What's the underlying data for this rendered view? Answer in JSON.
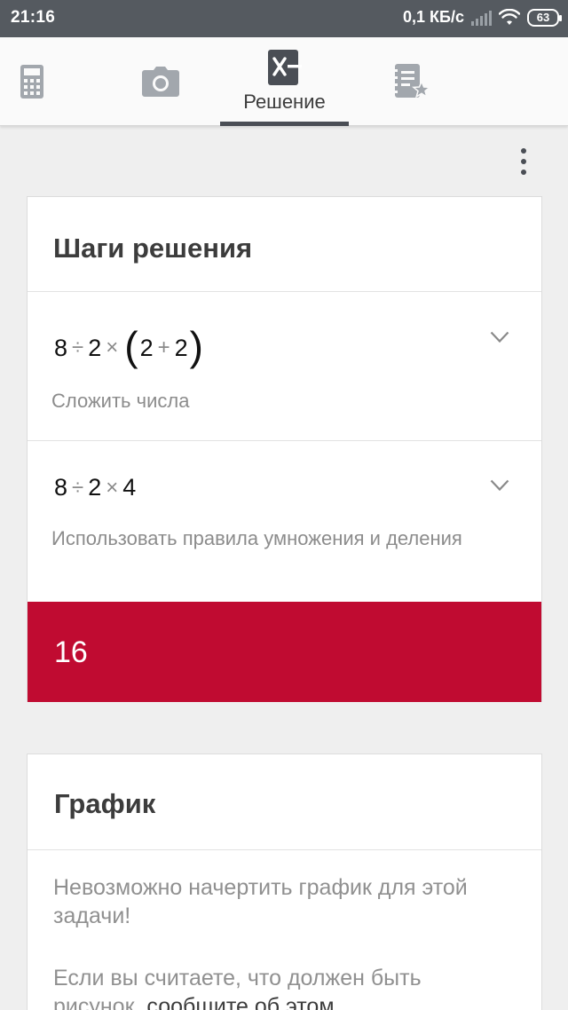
{
  "status_bar": {
    "time": "21:16",
    "network_speed": "0,1 КБ/с",
    "battery": "63"
  },
  "tabs": [
    {
      "icon": "calculator-icon",
      "label": ""
    },
    {
      "icon": "camera-icon",
      "label": ""
    },
    {
      "icon": "solution-icon",
      "label": "Решение",
      "active": true
    },
    {
      "icon": "saved-notes-icon",
      "label": ""
    }
  ],
  "steps_card": {
    "title": "Шаги решения",
    "steps": [
      {
        "expression": {
          "a": "8",
          "op1": "÷",
          "b": "2",
          "op2": "×",
          "open": "(",
          "c": "2",
          "op3": "+",
          "d": "2",
          "close": ")"
        },
        "description": "Сложить числа"
      },
      {
        "expression": {
          "a": "8",
          "op1": "÷",
          "b": "2",
          "op2": "×",
          "c": "4"
        },
        "description": "Использовать правила умножения и деления"
      }
    ],
    "result": "16"
  },
  "graph_card": {
    "title": "График",
    "message": "Невозможно начертить график для этой задачи!",
    "note_text": "Если вы считаете, что должен быть рисунок, ",
    "note_link": "сообщите об этом"
  },
  "colors": {
    "accent": "#c00b31",
    "status_bar": "#555a60",
    "icon_gray": "#9aa0a6"
  }
}
